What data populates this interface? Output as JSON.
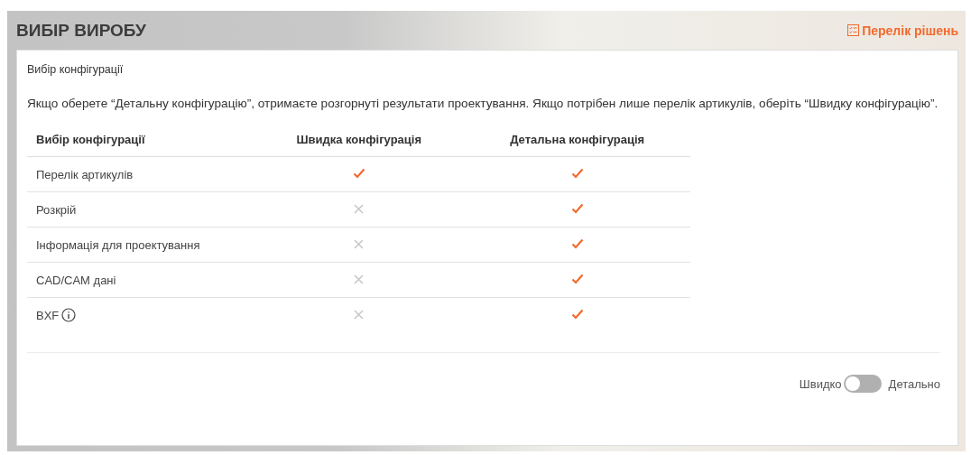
{
  "header": {
    "title": "ВИБІР ВИРОБУ",
    "link": "Перелік рішень"
  },
  "card": {
    "subtitle": "Вибір конфігурації",
    "description": "Якщо оберете “Детальну конфігурацію”, отримаєте розгорнуті результати проектування. Якщо потрібен лише перелік артикулів, оберіть “Швидку конфігурацію”."
  },
  "table": {
    "columns": [
      "Вибір конфігурації",
      "Швидка конфігурація",
      "Детальна конфігурація"
    ],
    "rows": [
      {
        "label": "Перелік артикулів",
        "info": false,
        "quick": true,
        "detailed": true
      },
      {
        "label": "Розкрій",
        "info": false,
        "quick": false,
        "detailed": true
      },
      {
        "label": "Інформація для проектування",
        "info": false,
        "quick": false,
        "detailed": true
      },
      {
        "label": "CAD/CAM дані",
        "info": false,
        "quick": false,
        "detailed": true
      },
      {
        "label": "BXF",
        "info": true,
        "quick": false,
        "detailed": true
      }
    ]
  },
  "toggle": {
    "left_label": "Швидко",
    "right_label": "Детально",
    "on": false
  }
}
